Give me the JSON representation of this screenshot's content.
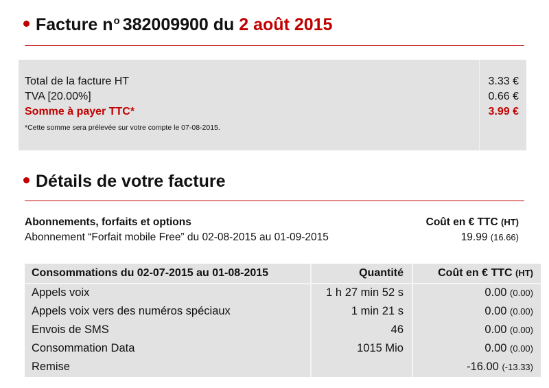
{
  "header": {
    "prefix": "Facture",
    "sup": "o",
    "number_label": "382009900 du",
    "date": "2 août 2015"
  },
  "summary": {
    "rows": [
      {
        "label": "Total de la facture HT",
        "value": "3.33 €"
      },
      {
        "label": "TVA [20.00%]",
        "value": "0.66 €"
      },
      {
        "label": "Somme à payer TTC*",
        "value": "3.99 €"
      }
    ],
    "note": "*Cette somme sera prélevée sur votre compte le 07-08-2015."
  },
  "details": {
    "title": "Détails de votre facture"
  },
  "subscriptions": {
    "header_label": "Abonnements, forfaits et options",
    "header_cost": "Coût en € TTC",
    "header_cost_ht": "(HT)",
    "row_label": "Abonnement “Forfait mobile Free” du 02-08-2015 au 01-09-2015",
    "row_value": "19.99",
    "row_value_ht": "(16.66)"
  },
  "consumption": {
    "header": {
      "label": "Consommations du 02-07-2015 au 01-08-2015",
      "qty": "Quantité",
      "cost": "Coût en € TTC",
      "cost_ht": "(HT)"
    },
    "rows": [
      {
        "label": "Appels voix",
        "qty": "1 h 27 min 52 s",
        "cost": "0.00",
        "cost_ht": "(0.00)"
      },
      {
        "label": "Appels voix vers des numéros spéciaux",
        "qty": "1 min 21 s",
        "cost": "0.00",
        "cost_ht": "(0.00)"
      },
      {
        "label": "Envois de SMS",
        "qty": "46",
        "cost": "0.00",
        "cost_ht": "(0.00)"
      },
      {
        "label": "Consommation Data",
        "qty": "1015 Mio",
        "cost": "0.00",
        "cost_ht": "(0.00)"
      },
      {
        "label": "Remise",
        "qty": "",
        "cost": "-16.00",
        "cost_ht": "(-13.33)"
      }
    ]
  },
  "colors": {
    "accent": "#c00000",
    "panel": "#e2e2e2"
  }
}
